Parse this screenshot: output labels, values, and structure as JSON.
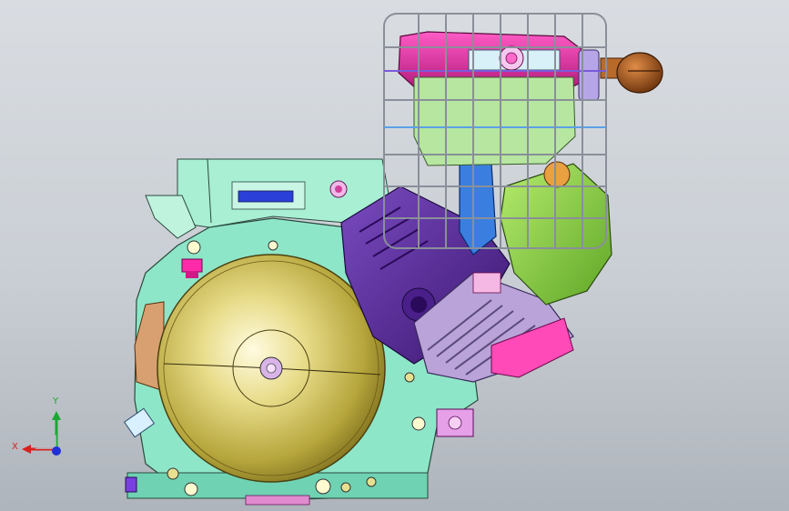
{
  "window": {
    "background_top": "#d9dde2",
    "background_bottom": "#aeb4bb"
  },
  "model": {
    "colors": {
      "crankcase": "#8ee6c8",
      "flywheel_cover": "#c9b84a",
      "cylinder": "#5a2b94",
      "head": "#b9a3d8",
      "air_cleaner": "#8fd14b",
      "fuel_tank": "#e43aa8",
      "tank_cap": "#7fd0d8",
      "cage": "#8a8f9a",
      "muffler_tip": "#a0521a",
      "carb": "#3a7fe0",
      "starter_shield": "#d8a070",
      "bolt_accent": "#ff2aa8"
    }
  },
  "triad": {
    "y_label": "Y",
    "x_label": "X",
    "icon": "coordinate-triad-icon",
    "y_color": "#1aa832",
    "x_color": "#d8201f",
    "z_color": "#2030d8"
  }
}
